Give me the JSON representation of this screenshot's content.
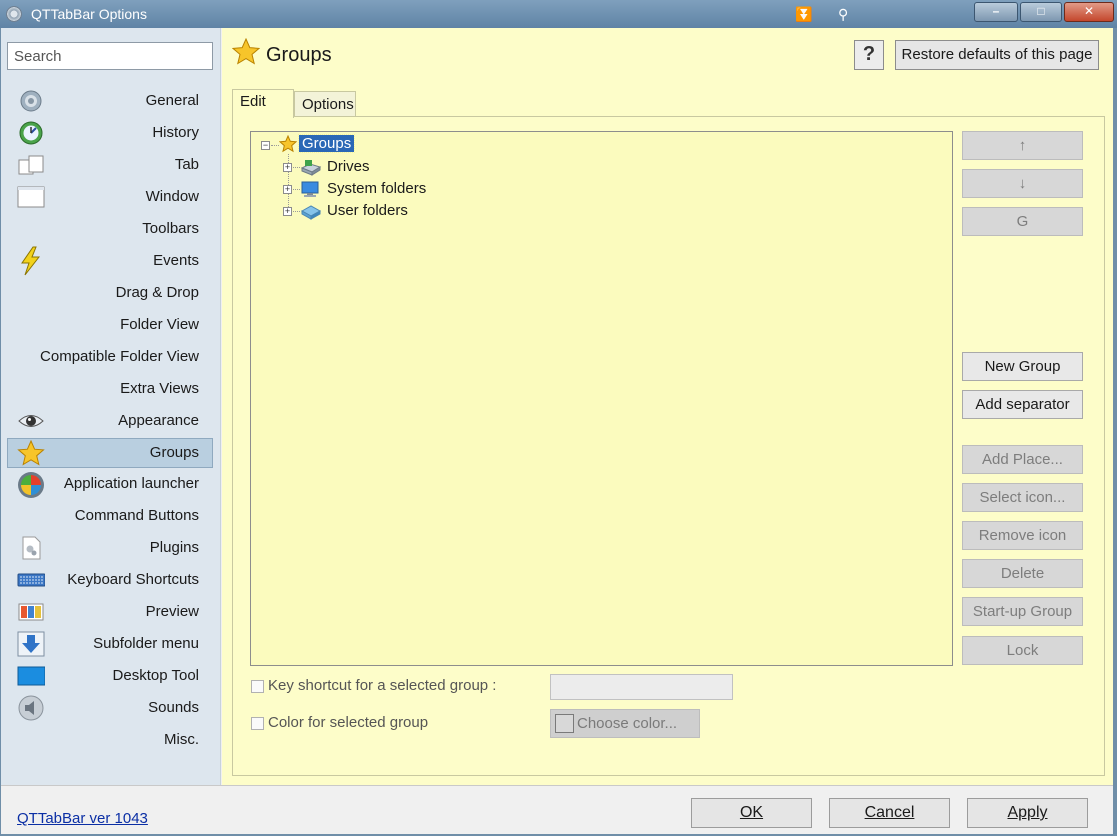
{
  "window": {
    "title": "QTTabBar Options",
    "minimize": "–",
    "maximize": "□",
    "close": "✕"
  },
  "search": {
    "placeholder": "Search"
  },
  "sidebar": {
    "items": [
      {
        "label": "General",
        "icon": "gear-icon"
      },
      {
        "label": "History",
        "icon": "clock-icon"
      },
      {
        "label": "Tab",
        "icon": "tab-icon"
      },
      {
        "label": "Window",
        "icon": "window-icon"
      },
      {
        "label": "Toolbars",
        "icon": "toolbars-icon"
      },
      {
        "label": "Events",
        "icon": "lightning-icon"
      },
      {
        "label": "Drag & Drop",
        "icon": "drag-drop-icon"
      },
      {
        "label": "Folder View",
        "icon": "folder-view-icon"
      },
      {
        "label": "Compatible Folder View",
        "icon": "compatible-folder-view-icon"
      },
      {
        "label": "Extra Views",
        "icon": "extra-views-icon"
      },
      {
        "label": "Appearance",
        "icon": "eye-icon"
      },
      {
        "label": "Groups",
        "icon": "star-icon",
        "selected": true
      },
      {
        "label": "Application launcher",
        "icon": "launcher-icon"
      },
      {
        "label": "Command Buttons",
        "icon": "command-buttons-icon"
      },
      {
        "label": "Plugins",
        "icon": "plugins-icon"
      },
      {
        "label": "Keyboard Shortcuts",
        "icon": "keyboard-icon"
      },
      {
        "label": "Preview",
        "icon": "preview-icon"
      },
      {
        "label": "Subfolder menu",
        "icon": "down-arrow-icon"
      },
      {
        "label": "Desktop Tool",
        "icon": "desktop-icon"
      },
      {
        "label": "Sounds",
        "icon": "speaker-icon"
      },
      {
        "label": "Misc.",
        "icon": "misc-icon"
      }
    ]
  },
  "page": {
    "title": "Groups",
    "help": "?",
    "restore_label": "Restore defaults of this page"
  },
  "tabs": [
    {
      "label": "Edit",
      "active": true
    },
    {
      "label": "Options",
      "active": false
    }
  ],
  "tree": {
    "root": "Groups",
    "children": [
      "Drives",
      "System folders",
      "User folders"
    ]
  },
  "side_buttons": {
    "up": "↑",
    "down": "↓",
    "reload": "G",
    "new_group": "New Group",
    "add_separator": "Add separator",
    "add_place": "Add Place...",
    "select_icon": "Select icon...",
    "remove_icon": "Remove icon",
    "delete": "Delete",
    "startup_group": "Start-up Group",
    "lock": "Lock"
  },
  "options": {
    "key_shortcut_label": "Key shortcut for a selected group :",
    "key_shortcut_value": "",
    "color_label": "Color for selected group",
    "choose_color_label": "Choose color..."
  },
  "footer": {
    "version": "QTTabBar ver 1043",
    "ok_label": "OK",
    "cancel_label": "Cancel",
    "apply_label": "Apply"
  }
}
